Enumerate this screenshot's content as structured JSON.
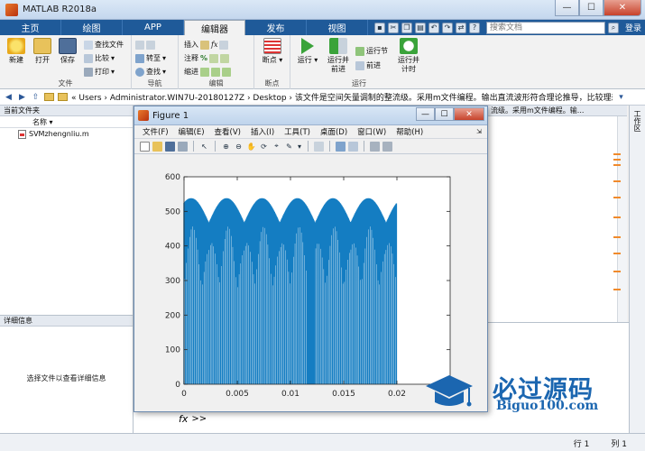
{
  "window": {
    "title": "MATLAB R2018a"
  },
  "tabs": [
    {
      "label": "主页",
      "active": false
    },
    {
      "label": "绘图",
      "active": false
    },
    {
      "label": "APP",
      "active": false
    },
    {
      "label": "编辑器",
      "active": true
    },
    {
      "label": "发布",
      "active": false
    },
    {
      "label": "视图",
      "active": false
    }
  ],
  "search": {
    "placeholder": "搜索文档"
  },
  "login": "登录",
  "ribbon": {
    "file_group": {
      "new": "新建",
      "open": "打开",
      "save": "保存",
      "find_files": "查找文件",
      "compare": "比较",
      "print": "打印",
      "label": "文件"
    },
    "nav_group": {
      "goto": "转至",
      "find": "查找",
      "label": "导航"
    },
    "edit_group": {
      "insert": "插入",
      "comment": "注释",
      "indent": "缩进",
      "fx": "fx",
      "label": "编辑"
    },
    "breakpoint_group": {
      "breakpoints": "断点",
      "label": "断点"
    },
    "run_group": {
      "run": "运行",
      "run_advance": "运行并\n前进",
      "run_section": "运行节",
      "advance": "前进",
      "run_time": "运行并\n计时",
      "label": "运行"
    }
  },
  "address": {
    "path": "« Users › Administrator.WIN7U-20180127Z › Desktop › 该文件是空间矢量调制的整流级。采用m文件编程。输出直流波形符合理论推导，比较理想"
  },
  "left_panel": {
    "title": "当前文件夹",
    "col_name": "名称",
    "files": [
      "SVMzhengnliu.m"
    ]
  },
  "details": {
    "title": "详细信息",
    "hint": "选择文件以查看详细信息"
  },
  "editor": {
    "tab_text": "流级。采用m文件编程。输... "
  },
  "right_dock": {
    "label": "工作区"
  },
  "command": {
    "prompt": ">>",
    "fx": "fx"
  },
  "status": {
    "row_label": "行",
    "row": "1",
    "col_label": "列",
    "col": "1"
  },
  "figure": {
    "title": "Figure 1",
    "menu": [
      "文件(F)",
      "编辑(E)",
      "查看(V)",
      "插入(I)",
      "工具(T)",
      "桌面(D)",
      "窗口(W)",
      "帮助(H)"
    ]
  },
  "chart_data": {
    "type": "line",
    "title": "",
    "xlabel": "",
    "ylabel": "",
    "xlim": [
      0,
      0.025
    ],
    "ylim": [
      0,
      600
    ],
    "xticks": [
      0,
      0.005,
      0.01,
      0.015,
      0.02
    ],
    "xtick_labels": [
      "0",
      "0.005",
      "0.01",
      "0.015",
      "0.02"
    ],
    "yticks": [
      0,
      100,
      200,
      300,
      400,
      500,
      600
    ],
    "ytick_labels": [
      "0",
      "100",
      "200",
      "300",
      "400",
      "500",
      "600"
    ],
    "series": [
      {
        "color": "#0072bd",
        "x_range": [
          0,
          0.02
        ],
        "envelope_peak": 538,
        "envelope_trough": 466,
        "ripple_period": 0.00333,
        "min_value": 0
      }
    ],
    "grid": false,
    "legend": null
  },
  "watermark": {
    "cn": "必过源码",
    "en": "Biguo100.com"
  }
}
